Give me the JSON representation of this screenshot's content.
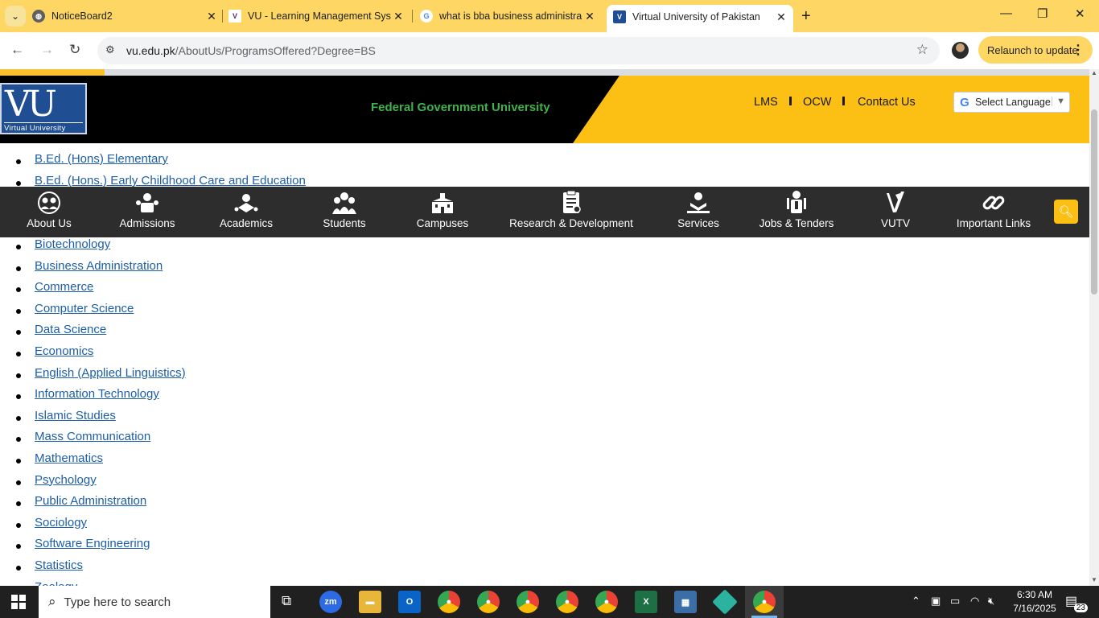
{
  "browser": {
    "tabs": [
      {
        "title": "NoticeBoard2",
        "favicon_color": "#5f5f5f"
      },
      {
        "title": "VU - Learning Management Sys",
        "favicon_color": "#5a2a82"
      },
      {
        "title": "what is bba business administra",
        "favicon_color": "#4285f4"
      },
      {
        "title": "Virtual University of Pakistan",
        "favicon_color": "#1f4f92",
        "active": true
      }
    ],
    "url_host": "vu.edu.pk",
    "url_path": "/AboutUs/ProgramsOffered?Degree=BS",
    "relaunch_label": "Relaunch to update",
    "accent": "#fdd663"
  },
  "header": {
    "logo_text": "VU",
    "logo_subtext": "Virtual University",
    "tagline": "Federal Government University",
    "links": [
      "LMS",
      "OCW",
      "Contact Us"
    ],
    "language_label": "Select Language",
    "brand_yellow": "#fcbf13",
    "tagline_green": "#3fb24b"
  },
  "programs_above_nav": [
    "B.Ed. (Hons) Elementary",
    "B.Ed. (Hons.) Early Childhood Care and Education"
  ],
  "nav": {
    "items": [
      {
        "label": "About Us",
        "icon": "people-circle-icon"
      },
      {
        "label": "Admissions",
        "icon": "admissions-icon"
      },
      {
        "label": "Academics",
        "icon": "academics-icon"
      },
      {
        "label": "Students",
        "icon": "students-icon"
      },
      {
        "label": "Campuses",
        "icon": "campus-building-icon"
      },
      {
        "label": "Research & Development",
        "icon": "clipboard-icon"
      },
      {
        "label": "Services",
        "icon": "services-hand-icon"
      },
      {
        "label": "Jobs & Tenders",
        "icon": "jobs-icon"
      },
      {
        "label": "VUTV",
        "icon": "vutv-icon"
      },
      {
        "label": "Important Links",
        "icon": "link-icon"
      }
    ]
  },
  "programs": [
    "Biotechnology",
    "Business Administration",
    "Commerce",
    "Computer Science",
    "Data Science",
    "Economics",
    "English (Applied Linguistics)",
    "Information Technology",
    "Islamic Studies",
    "Mass Communication",
    "Mathematics",
    "Psychology",
    "Public Administration",
    "Sociology",
    "Software Engineering",
    "Statistics",
    "Zoology"
  ],
  "link_color": "#1c5ea8",
  "taskbar": {
    "search_placeholder": "Type here to search",
    "time": "6:30 AM",
    "date": "7/16/2025",
    "notification_count": "23"
  }
}
